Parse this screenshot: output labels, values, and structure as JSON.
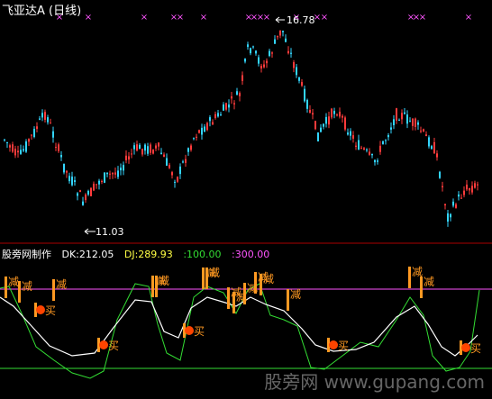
{
  "title": "飞亚达A (日线)",
  "colors": {
    "up": "#ff3b3b",
    "down": "#33d6ff",
    "pink": "#ff55ff",
    "orange": "#ff9922",
    "green": "#33dd33",
    "white": "#ffffff",
    "yellow": "#ffff44",
    "divider": "#aa0000"
  },
  "main_chart": {
    "high_label": "16.78",
    "low_label": "11.03",
    "marker_symbol": "×"
  },
  "indicator": {
    "name": "股旁网制作",
    "dk_label": "DK:212.05",
    "dj_label": "DJ:289.93",
    "level1_label": ":100.00",
    "level2_label": ":300.00",
    "reduce_label": "减",
    "buy_label": "买"
  },
  "watermark": "股旁网  www.gupang.com"
}
